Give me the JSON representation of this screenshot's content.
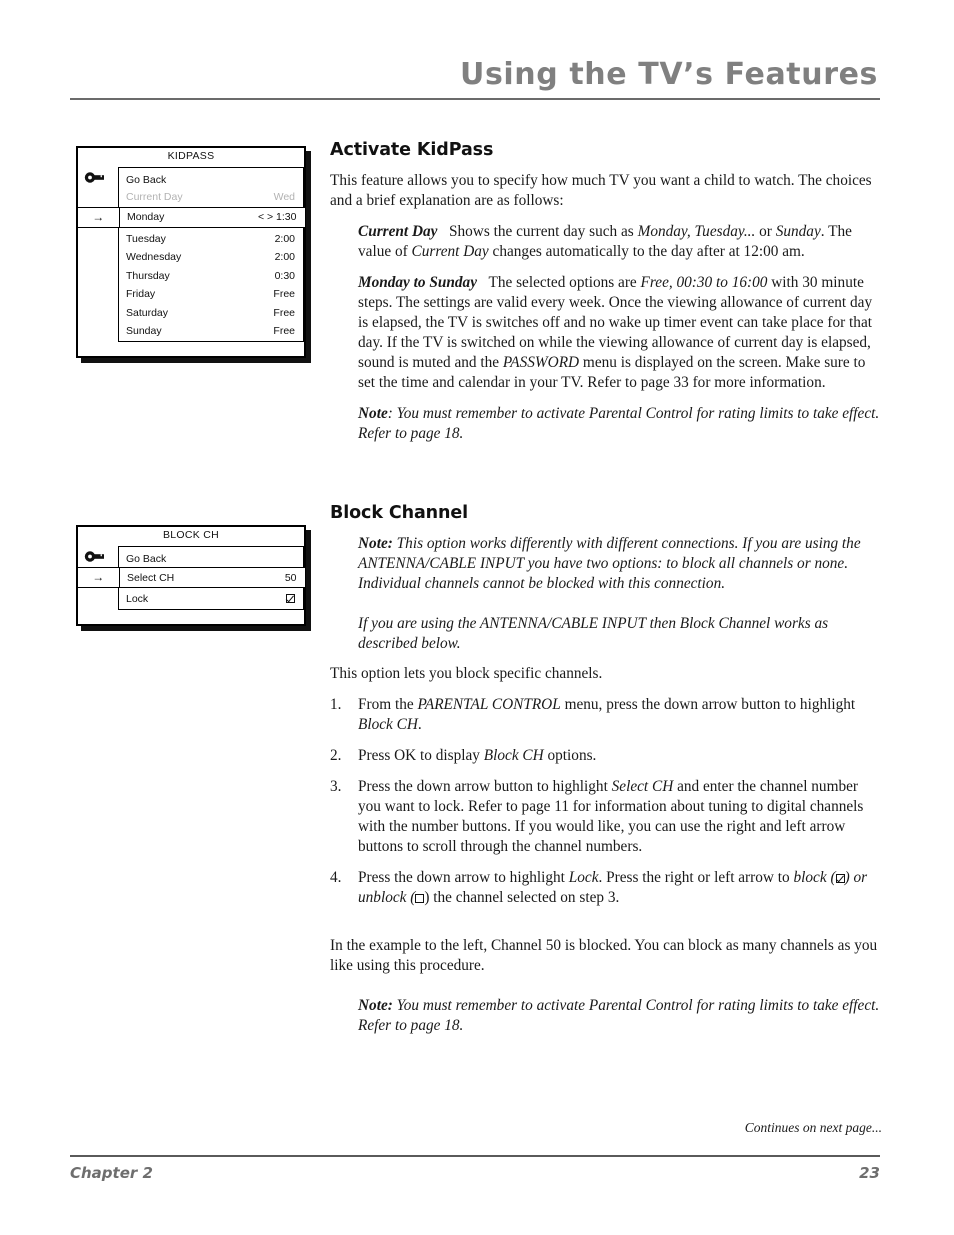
{
  "header": {
    "title": "Using the TV’s Features"
  },
  "figures": {
    "kidpass": {
      "icon": "key-icon",
      "title": "KIDPASS",
      "rows": [
        {
          "label": "Go Back",
          "value": "",
          "state": "normal"
        },
        {
          "label": "Current Day",
          "value": "Wed",
          "state": "dim"
        },
        {
          "label": "Monday",
          "value": "< > 1:30",
          "state": "highlighted",
          "pointer": "→"
        },
        {
          "label": "Tuesday",
          "value": "2:00",
          "state": "normal"
        },
        {
          "label": "Wednesday",
          "value": "2:00",
          "state": "normal"
        },
        {
          "label": "Thursday",
          "value": "0:30",
          "state": "normal"
        },
        {
          "label": "Friday",
          "value": "Free",
          "state": "normal"
        },
        {
          "label": "Saturday",
          "value": "Free",
          "state": "normal"
        },
        {
          "label": "Sunday",
          "value": "Free",
          "state": "normal"
        }
      ]
    },
    "blockch": {
      "icon": "key-icon",
      "title": "BLOCK CH",
      "rows": [
        {
          "label": "Go Back",
          "value": "",
          "state": "normal"
        },
        {
          "label": "Select CH",
          "value": "50",
          "state": "highlighted",
          "pointer": "→"
        },
        {
          "label": "Lock",
          "value": "checked-checkbox",
          "state": "checkbox"
        }
      ]
    }
  },
  "sections": {
    "kidpass": {
      "heading": "Activate KidPass",
      "intro": "This feature allows you to specify how much TV you want a child to watch. The choices and a brief explanation are as follows:",
      "current_day_term": "Current Day",
      "current_day_p1": "Shows the current day such as ",
      "current_day_i1": "Monday, Tuesday...",
      "current_day_p2": " or ",
      "current_day_i2": "Sunday",
      "current_day_p3": ". The value of ",
      "current_day_i3": "Current Day",
      "current_day_p4": " changes automatically to the day after at 12:00 am.",
      "monday_term": "Monday to Sunday",
      "monday_p1": "The selected options are ",
      "monday_i1": "Free, 00:30 to 16:00",
      "monday_p2": " with 30 minute steps. The settings are valid every week. Once the viewing allowance of current day is elapsed, the TV is switches off and no wake up timer event can take place for that day. If the TV is switched on while the viewing allowance of current day is elapsed, sound is muted and the ",
      "monday_i2": "PASSWORD",
      "monday_p3": " menu is displayed on the screen. Make sure to set the time and calendar in your TV. Refer to page 33 for more information.",
      "note_label": "Note",
      "note_text": ": You must remember to activate Parental Control for rating limits to take effect. Refer to page 18."
    },
    "blockchannel": {
      "heading": "Block Channel",
      "note1_label": "Note:",
      "note1_text": " This option works differently with different connections. If you are using the ANTENNA/CABLE INPUT you have two options: to block all channels or none. Individual channels cannot be blocked with this connection.",
      "note2_text": "If you are using the ANTENNA/CABLE INPUT then Block Channel works as described below.",
      "intro": "This option lets you block specific channels.",
      "steps": [
        {
          "num": "1.",
          "p1": "From the ",
          "i1": "PARENTAL CONTROL",
          "p2": " menu, press the down arrow button to highlight ",
          "i2": "Block CH",
          "p3": "."
        },
        {
          "num": "2.",
          "p1": "Press OK to display ",
          "i1": "Block CH",
          "p2": " options.",
          "i2": "",
          "p3": ""
        },
        {
          "num": "3.",
          "p1": "Press the down arrow button to highlight ",
          "i1": "Select CH",
          "p2": " and enter the channel number you want to lock. Refer to page 11 for information about tuning to digital channels with the number buttons. If you would like, you can use the right and left arrow buttons to scroll through the channel numbers.",
          "i2": "",
          "p3": ""
        }
      ],
      "step4": {
        "num": "4.",
        "p1": "Press the down arrow to highlight ",
        "i1": "Lock",
        "p2": ". Press the right or left arrow to ",
        "i2": "block",
        "p3": " (",
        "checked_icon": "checked-checkbox-icon",
        "p4": ") or ",
        "i3": "unblock",
        "p5": " (",
        "unchecked_icon": "unchecked-checkbox-icon",
        "p6": ") the channel selected on step 3."
      },
      "example": "In the example to the left, Channel 50 is blocked. You can block as many channels as you like using this procedure.",
      "note3_label": "Note:",
      "note3_text": " You must remember to activate Parental Control for rating limits to take effect. Refer to page 18."
    }
  },
  "footer": {
    "continues": "Continues on next page...",
    "chapter": "Chapter 2",
    "page_number": "23"
  }
}
